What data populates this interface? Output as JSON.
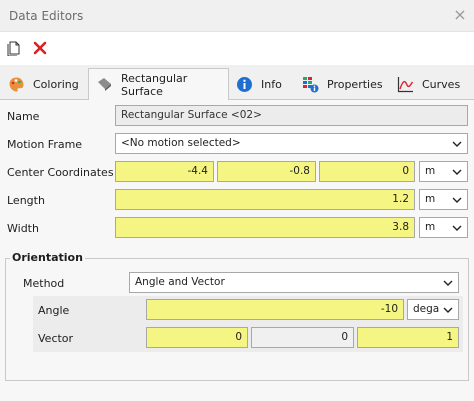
{
  "window": {
    "title": "Data Editors"
  },
  "toolbar": {
    "new_icon": "new-document-icon",
    "delete_icon": "delete-x-icon"
  },
  "tabs": [
    {
      "label": "Coloring",
      "icon": "palette-icon"
    },
    {
      "label": "Rectangular Surface",
      "icon": "surface-icon"
    },
    {
      "label": "Info",
      "icon": "info-icon"
    },
    {
      "label": "Properties",
      "icon": "properties-icon"
    },
    {
      "label": "Curves",
      "icon": "curves-icon"
    }
  ],
  "form": {
    "name_label": "Name",
    "name_value": "Rectangular Surface <02>",
    "motion_frame_label": "Motion Frame",
    "motion_frame_value": "<No motion selected>",
    "center_label": "Center Coordinates",
    "center_x": "-4.4",
    "center_y": "-0.8",
    "center_z": "0",
    "center_unit": "m",
    "length_label": "Length",
    "length_value": "1.2",
    "length_unit": "m",
    "width_label": "Width",
    "width_value": "3.8",
    "width_unit": "m"
  },
  "orientation": {
    "title": "Orientation",
    "method_label": "Method",
    "method_value": "Angle and Vector",
    "angle_label": "Angle",
    "angle_value": "-10",
    "angle_unit": "dega",
    "vector_label": "Vector",
    "vector_x": "0",
    "vector_y": "0",
    "vector_z": "1"
  },
  "colors": {
    "highlight": "#f5f583",
    "accent_blue": "#1f6fd1",
    "delete_red": "#e02020"
  }
}
